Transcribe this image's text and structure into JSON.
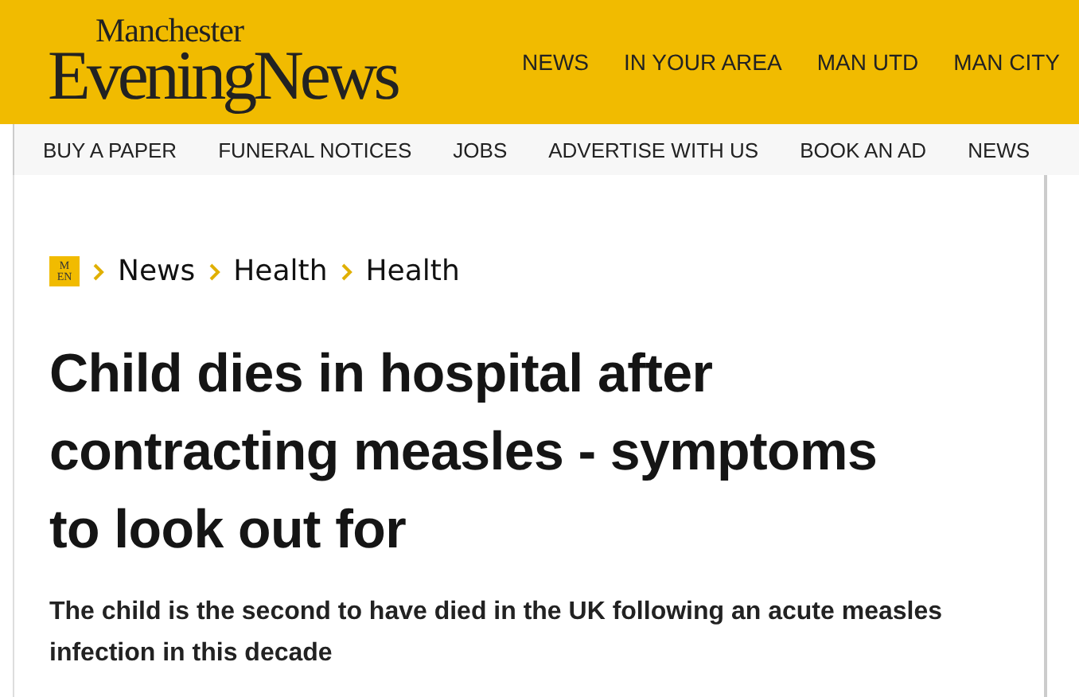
{
  "masthead": {
    "logo_top": "Manchester",
    "logo_main": "EveningNews",
    "nav": [
      "NEWS",
      "IN YOUR AREA",
      "MAN UTD",
      "MAN CITY"
    ]
  },
  "subnav": [
    "BUY A PAPER",
    "FUNERAL NOTICES",
    "JOBS",
    "ADVERTISE WITH US",
    "BOOK AN AD",
    "NEWS"
  ],
  "breadcrumb": {
    "badge_top": "M",
    "badge_bottom": "EN",
    "items": [
      "News",
      "Health",
      "Health"
    ]
  },
  "article": {
    "headline": "Child dies in hospital after contracting measles - symptoms to look out for",
    "standfirst": "The child is the second to have died in the UK following an acute measles infection in this decade"
  }
}
